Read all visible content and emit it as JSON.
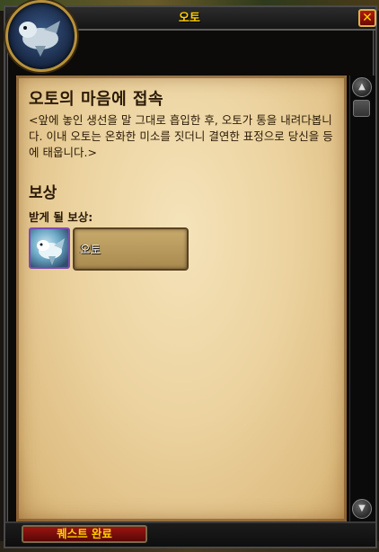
{
  "window": {
    "title": "오토",
    "close_icon": "close-icon"
  },
  "quest": {
    "title": "오토의 마음에 접속",
    "text": "<앞에 놓인 생선을 말 그대로 흡입한 후, 오토가 통을 내려다봅니다. 이내 오토는 온화한 미소를 짓더니 결연한 표정으로 당신을 등에 태웁니다.>"
  },
  "rewards": {
    "heading": "보상",
    "subheading": "받게 될 보상:",
    "items": [
      {
        "label": "오토",
        "icon": "otto-mount-icon"
      }
    ]
  },
  "footer": {
    "complete_button": "퀘스트 완료"
  },
  "colors": {
    "title_gold": "#ffd100",
    "parchment": "#ecd3a0",
    "text_dark": "#2a1a06",
    "button_red": "#9a1410",
    "reward_border_purple": "#7b4bb0"
  }
}
